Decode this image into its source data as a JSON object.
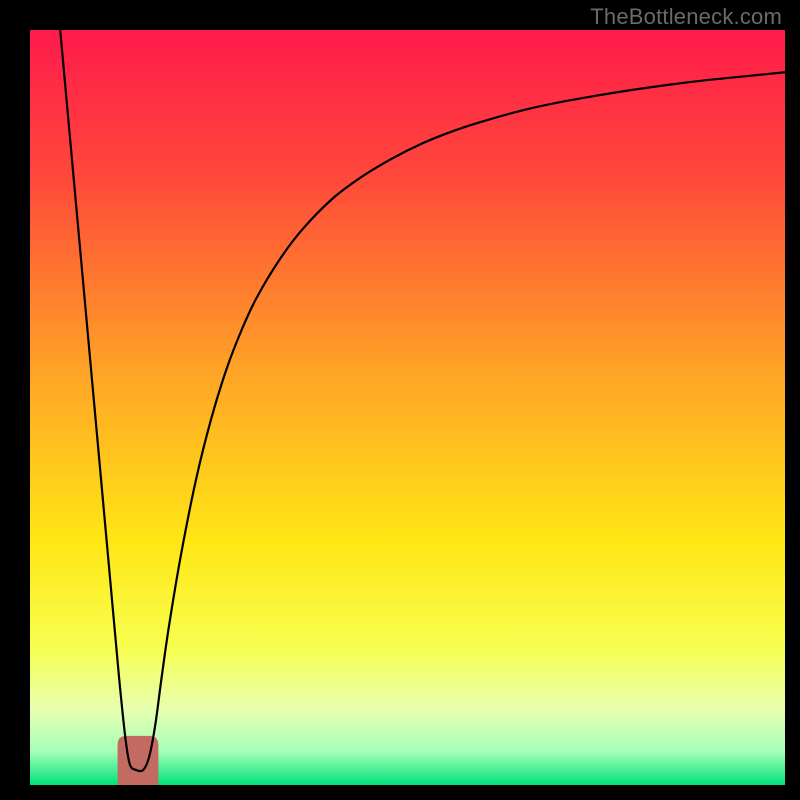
{
  "watermark": "TheBottleneck.com",
  "chart_data": {
    "type": "line",
    "title": "",
    "xlabel": "",
    "ylabel": "",
    "xlim": [
      0,
      100
    ],
    "ylim": [
      0,
      100
    ],
    "background_gradient": {
      "stops": [
        {
          "offset": 0.0,
          "color": "#ff1a4b"
        },
        {
          "offset": 0.2,
          "color": "#ff4a3a"
        },
        {
          "offset": 0.45,
          "color": "#ffa326"
        },
        {
          "offset": 0.68,
          "color": "#ffe714"
        },
        {
          "offset": 0.82,
          "color": "#f7ff52"
        },
        {
          "offset": 0.9,
          "color": "#e8ffb0"
        },
        {
          "offset": 0.955,
          "color": "#a6ffb8"
        },
        {
          "offset": 1.0,
          "color": "#00e27a"
        }
      ]
    },
    "dimple": {
      "x_center": 14.3,
      "width": 5.4,
      "y": 93.5,
      "color": "#c36a63"
    },
    "series": [
      {
        "name": "bottleneck-curve",
        "color": "#000000",
        "x": [
          4.0,
          6.0,
          8.0,
          10.0,
          11.0,
          11.8,
          12.6,
          13.2,
          14.0,
          15.0,
          15.8,
          16.6,
          17.4,
          18.4,
          20.0,
          22.0,
          24.0,
          26.0,
          28.0,
          30.0,
          33.0,
          36.0,
          40.0,
          44.0,
          48.0,
          52.0,
          56.0,
          60.0,
          65.0,
          70.0,
          75.0,
          80.0,
          85.0,
          90.0,
          95.0,
          100.0
        ],
        "values": [
          100.0,
          78.0,
          56.0,
          34.0,
          23.0,
          14.2,
          6.5,
          2.8,
          2.0,
          2.0,
          3.8,
          8.0,
          14.0,
          21.0,
          30.5,
          40.5,
          48.5,
          55.0,
          60.2,
          64.5,
          69.5,
          73.5,
          77.6,
          80.6,
          83.0,
          85.0,
          86.6,
          87.9,
          89.3,
          90.4,
          91.3,
          92.1,
          92.8,
          93.4,
          93.9,
          94.4
        ]
      }
    ]
  }
}
